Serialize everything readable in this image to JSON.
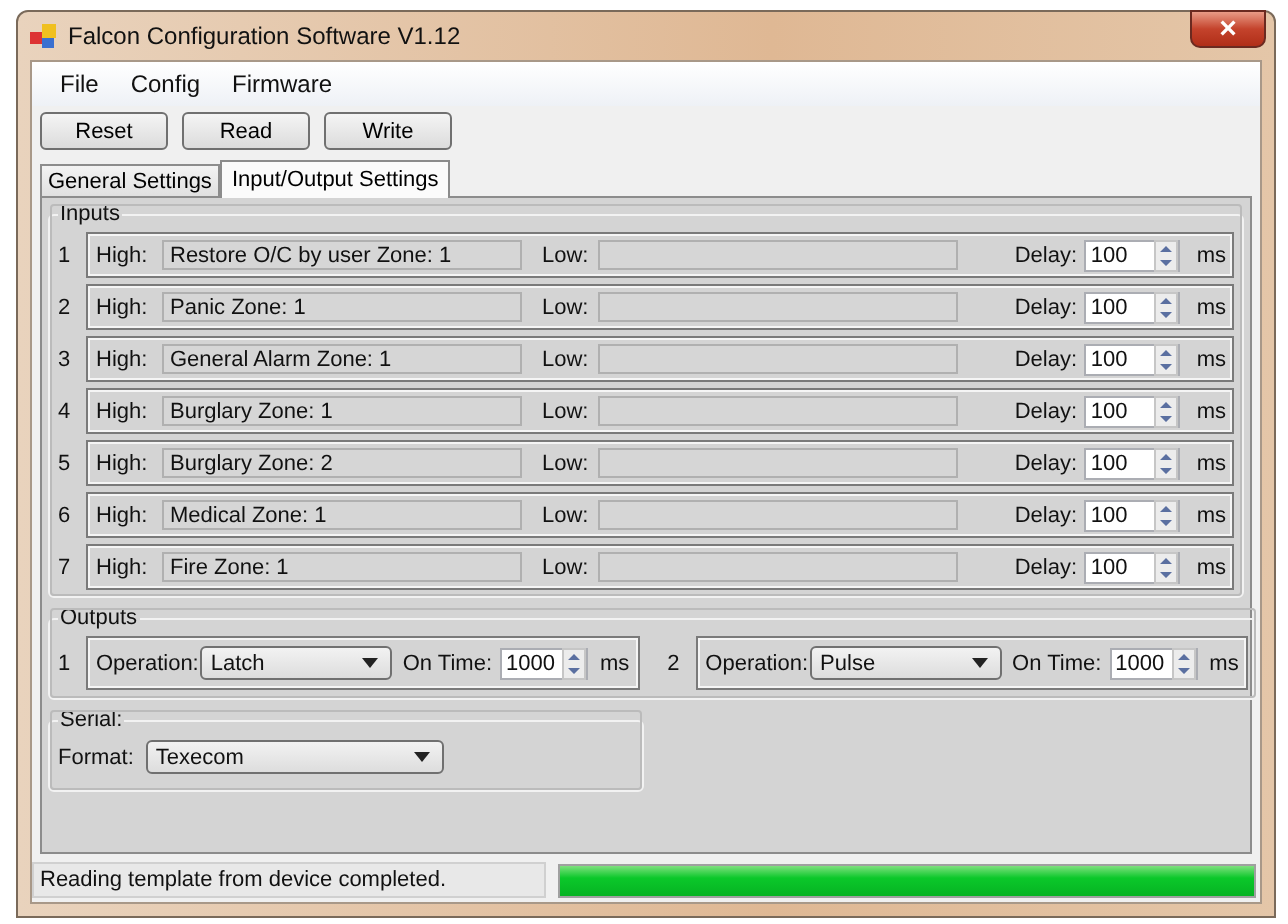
{
  "window": {
    "title": "Falcon Configuration Software V1.12",
    "close": "×"
  },
  "menu": [
    "File",
    "Config",
    "Firmware"
  ],
  "toolbar": [
    "Reset",
    "Read",
    "Write"
  ],
  "tabs": [
    {
      "label": "General Settings",
      "selected": false
    },
    {
      "label": "Input/Output Settings",
      "selected": true
    }
  ],
  "inputs": {
    "title": "Inputs",
    "rows": [
      {
        "number": "1",
        "high_label": "High:",
        "high": "Restore O/C by user Zone: 1",
        "low_label": "Low:",
        "delay_label": "Delay:",
        "delay": "100",
        "unit": "ms"
      },
      {
        "number": "2",
        "high_label": "High:",
        "high": "Panic Zone: 1",
        "low_label": "Low:",
        "delay_label": "Delay:",
        "delay": "100",
        "unit": "ms"
      },
      {
        "number": "3",
        "high_label": "High:",
        "high": "General Alarm Zone: 1",
        "low_label": "Low:",
        "delay_label": "Delay:",
        "delay": "100",
        "unit": "ms"
      },
      {
        "number": "4",
        "high_label": "High:",
        "high": "Burglary Zone: 1",
        "low_label": "Low:",
        "delay_label": "Delay:",
        "delay": "100",
        "unit": "ms"
      },
      {
        "number": "5",
        "high_label": "High:",
        "high": "Burglary Zone: 2",
        "low_label": "Low:",
        "delay_label": "Delay:",
        "delay": "100",
        "unit": "ms"
      },
      {
        "number": "6",
        "high_label": "High:",
        "high": "Medical Zone: 1",
        "low_label": "Low:",
        "delay_label": "Delay:",
        "delay": "100",
        "unit": "ms"
      },
      {
        "number": "7",
        "high_label": "High:",
        "high": "Fire Zone: 1",
        "low_label": "Low:",
        "delay_label": "Delay:",
        "delay": "100",
        "unit": "ms"
      }
    ]
  },
  "outputs": {
    "title": "Outputs",
    "items": [
      {
        "number": "1",
        "operation_label": "Operation:",
        "operation": "Latch",
        "on_time_label": "On Time:",
        "on_time": "1000",
        "unit": "ms"
      },
      {
        "number": "2",
        "operation_label": "Operation:",
        "operation": "Pulse",
        "on_time_label": "On Time:",
        "on_time": "1000",
        "unit": "ms"
      }
    ]
  },
  "serial": {
    "title": "Serial:",
    "format_label": "Format:",
    "format": "Texecom"
  },
  "status_bar": {
    "message": "Reading template from device completed.",
    "progress": {
      "level": 1.0
    }
  }
}
